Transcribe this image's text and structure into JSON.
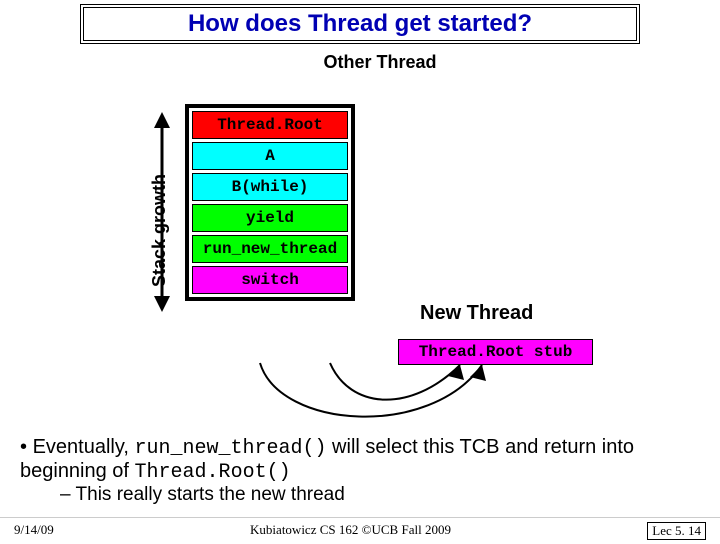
{
  "title": "How does Thread get started?",
  "other_thread_label": "Other Thread",
  "growth_label": "Stack growth",
  "stack": {
    "cells": [
      {
        "label": "Thread.Root",
        "color": "red"
      },
      {
        "label": "A",
        "color": "cyan"
      },
      {
        "label": "B(while)",
        "color": "cyan"
      },
      {
        "label": "yield",
        "color": "green"
      },
      {
        "label": "run_new_thread",
        "color": "green"
      },
      {
        "label": "switch",
        "color": "magenta"
      }
    ]
  },
  "new_thread_label": "New Thread",
  "stub_label": "Thread.Root stub",
  "bullets": {
    "line1_pre": "Eventually, ",
    "line1_code": "run_new_thread()",
    "line1_post": " will select this TCB and return into beginning of ",
    "line1_code2": "Thread.Root()",
    "sub": "This really starts the new thread"
  },
  "footer": {
    "date": "9/14/09",
    "center": "Kubiatowicz CS 162 ©UCB Fall 2009",
    "lec": "Lec 5. 14"
  }
}
